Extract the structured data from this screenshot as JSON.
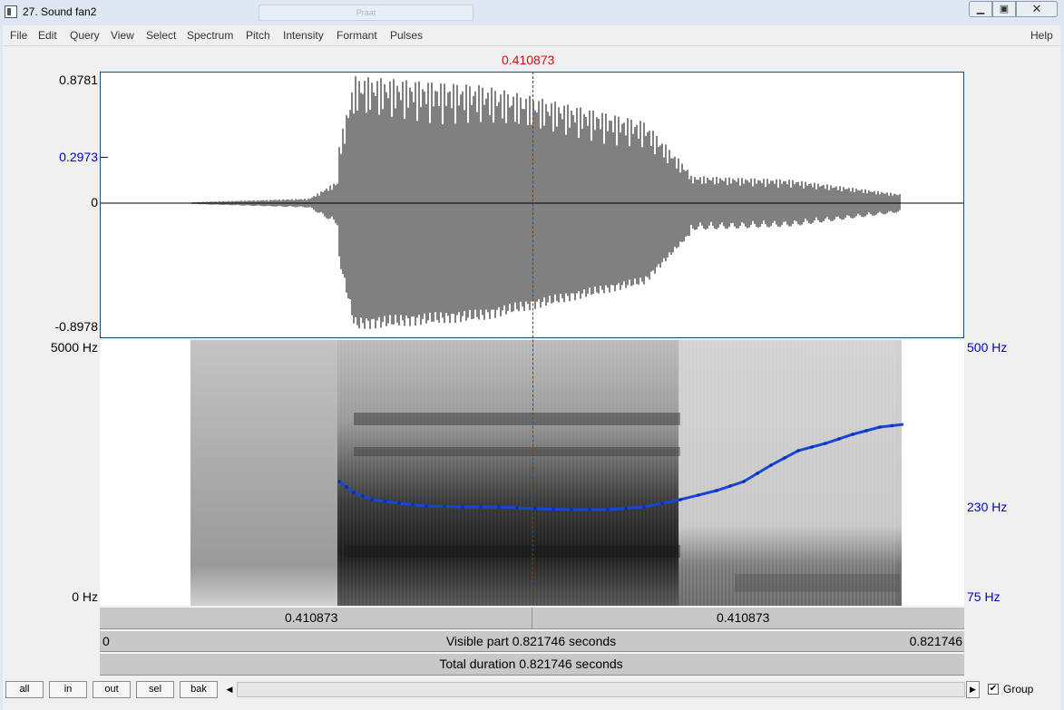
{
  "window": {
    "title": "27. Sound fan2",
    "background_tab_text": "Praat"
  },
  "menu": [
    "File",
    "Edit",
    "Query",
    "View",
    "Select",
    "Spectrum",
    "Pitch",
    "Intensity",
    "Formant",
    "Pulses"
  ],
  "help": "Help",
  "cursor_time": "0.410873",
  "waveform": {
    "max_label": "0.8781",
    "cursor_value": "0.2973",
    "zero_label": "0",
    "min_label": "-0.8978"
  },
  "spectrogram": {
    "freq_top": "5000 Hz",
    "freq_bottom": "0 Hz"
  },
  "pitch_axis": {
    "top": "500 Hz",
    "cursor": "230 Hz",
    "bottom": "75 Hz"
  },
  "time_bars": {
    "left_segment": "0.410873",
    "right_segment": "0.410873",
    "visible_start": "0",
    "visible_part": "Visible part 0.821746 seconds",
    "visible_end": "0.821746",
    "total_duration": "Total duration 0.821746 seconds"
  },
  "buttons": {
    "all": "all",
    "in": "in",
    "out": "out",
    "sel": "sel",
    "bak": "bak"
  },
  "group_label": "Group",
  "colors": {
    "cursor": "#d01010",
    "pitch": "#1646d8",
    "axis_blue": "#0000c8"
  },
  "icons": {
    "minimize": "minimize-icon",
    "maximize": "maximize-icon",
    "close": "close-icon",
    "scroll_left": "scroll-left-icon",
    "scroll_right": "scroll-right-icon",
    "checkbox": "checkmark-icon"
  }
}
